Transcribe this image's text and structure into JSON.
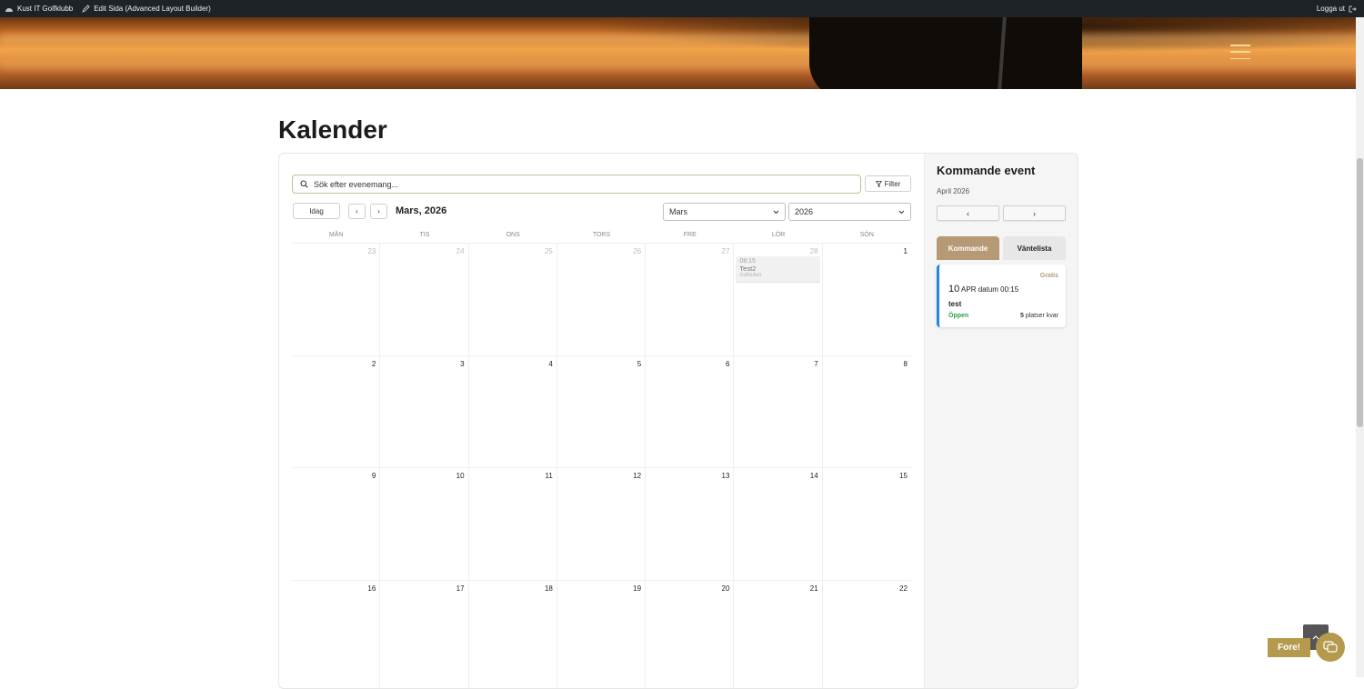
{
  "adminbar": {
    "site_name": "Kust IT Golfklubb",
    "edit_label": "Edit Sida (Advanced Layout Builder)",
    "logout_label": "Logga ut"
  },
  "page": {
    "title": "Kalender"
  },
  "calendar": {
    "search_placeholder": "Sök efter evenemang...",
    "filter_label": "Filter",
    "today_label": "Idag",
    "prev_label": "‹",
    "next_label": "›",
    "month_title": "Mars, 2026",
    "month_select": "Mars",
    "year_select": "2026",
    "weekdays": [
      "MÅN",
      "TIS",
      "ONS",
      "TORS",
      "FRE",
      "LÖR",
      "SÖN"
    ],
    "days": [
      {
        "n": "23",
        "muted": true
      },
      {
        "n": "24",
        "muted": true
      },
      {
        "n": "25",
        "muted": true
      },
      {
        "n": "26",
        "muted": true
      },
      {
        "n": "27",
        "muted": true
      },
      {
        "n": "28",
        "muted": true
      },
      {
        "n": "1",
        "muted": false
      },
      {
        "n": "2",
        "muted": false
      },
      {
        "n": "3",
        "muted": false
      },
      {
        "n": "4",
        "muted": false
      },
      {
        "n": "5",
        "muted": false
      },
      {
        "n": "6",
        "muted": false
      },
      {
        "n": "7",
        "muted": false
      },
      {
        "n": "8",
        "muted": false
      },
      {
        "n": "9",
        "muted": false
      },
      {
        "n": "10",
        "muted": false
      },
      {
        "n": "11",
        "muted": false
      },
      {
        "n": "12",
        "muted": false
      },
      {
        "n": "13",
        "muted": false
      },
      {
        "n": "14",
        "muted": false
      },
      {
        "n": "15",
        "muted": false
      },
      {
        "n": "16",
        "muted": false
      },
      {
        "n": "17",
        "muted": false
      },
      {
        "n": "18",
        "muted": false
      },
      {
        "n": "19",
        "muted": false
      },
      {
        "n": "20",
        "muted": false
      },
      {
        "n": "21",
        "muted": false
      },
      {
        "n": "22",
        "muted": false
      }
    ],
    "event": {
      "day_index": 5,
      "time": "08:15",
      "title": "Test2",
      "sub": "Avbruten"
    }
  },
  "sidebar": {
    "title": "Kommande event",
    "month_label": "April 2026",
    "prev_label": "‹",
    "next_label": "›",
    "tab_active": "Kommande",
    "tab_inactive": "Väntelista",
    "card": {
      "price": "Gratis",
      "day": "10",
      "date_rest": "APR datum 00:15",
      "name": "test",
      "status": "Öppen",
      "spots_count": "5",
      "spots_label": "platser kvar"
    }
  },
  "widgets": {
    "fore_label": "Fore!"
  },
  "colors": {
    "accent": "#b59a75",
    "brand_gold": "#b59a4e",
    "card_border": "#1e88e5",
    "status_open": "#2ea043"
  }
}
